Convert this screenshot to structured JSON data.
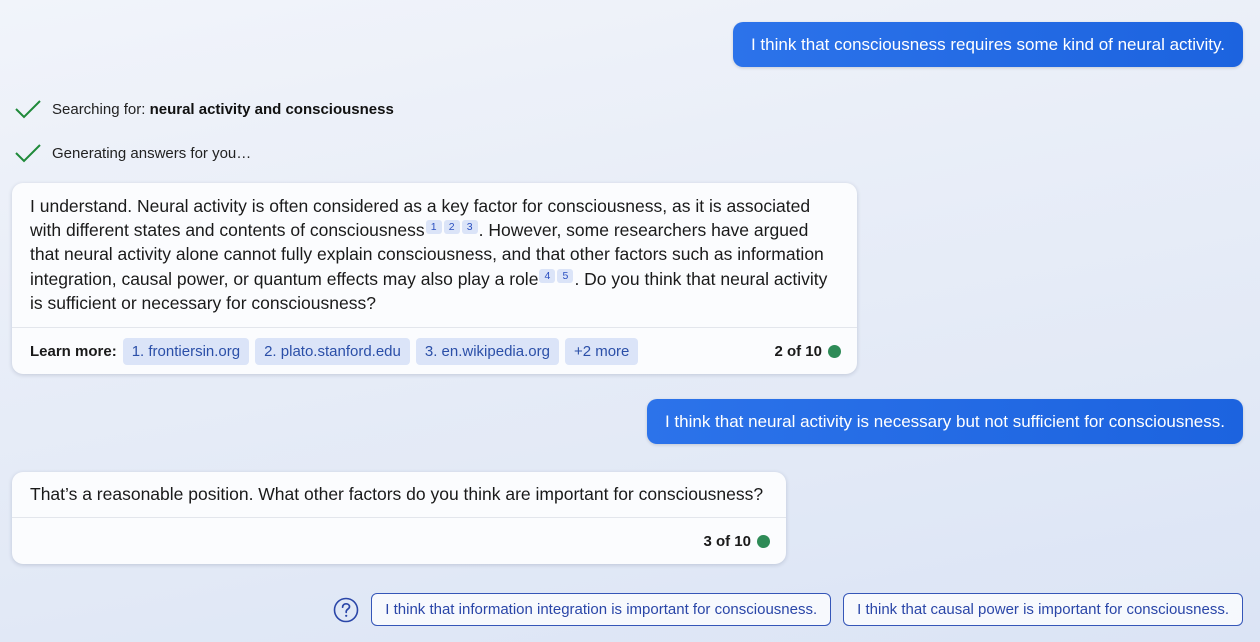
{
  "user_messages": [
    "I think that consciousness requires some kind of neural activity.",
    "I think that neural activity is necessary but not sufficient for consciousness."
  ],
  "status": {
    "searching_prefix": "Searching for: ",
    "searching_query": "neural activity and consciousness",
    "generating": "Generating answers for you…"
  },
  "bot_1": {
    "seg1": "I understand. Neural activity is often considered as a key factor for consciousness, as it is associated with different states and contents of consciousness",
    "seg2": ". However, some researchers have argued that neural activity alone cannot fully explain consciousness, and that other factors such as information integration, causal power, or quantum effects may also play a role",
    "seg3": ". Do you think that neural activity is sufficient or necessary for consciousness?",
    "citations_a": [
      "1",
      "2",
      "3"
    ],
    "citations_b": [
      "4",
      "5"
    ],
    "learn_more_label": "Learn more:",
    "sources": [
      "1. frontiersin.org",
      "2. plato.stanford.edu",
      "3. en.wikipedia.org",
      "+2 more"
    ],
    "counter": "2 of 10"
  },
  "bot_2": {
    "text": "That’s a reasonable position. What other factors do you think are important for consciousness?",
    "counter": "3 of 10"
  },
  "suggestions": [
    "I think that information integration is important for consciousness.",
    "I think that causal power is important for consciousness."
  ],
  "colors": {
    "user_bubble": "#1c63df",
    "status_dot": "#2e8b57",
    "check": "#1f8a3a",
    "pill_bg": "#dbe4f8",
    "suggestion_border": "#3556b8"
  },
  "icons": {
    "status_check": "checkmark-icon",
    "help": "question-circle-icon",
    "status_dot": "green-dot-icon"
  }
}
